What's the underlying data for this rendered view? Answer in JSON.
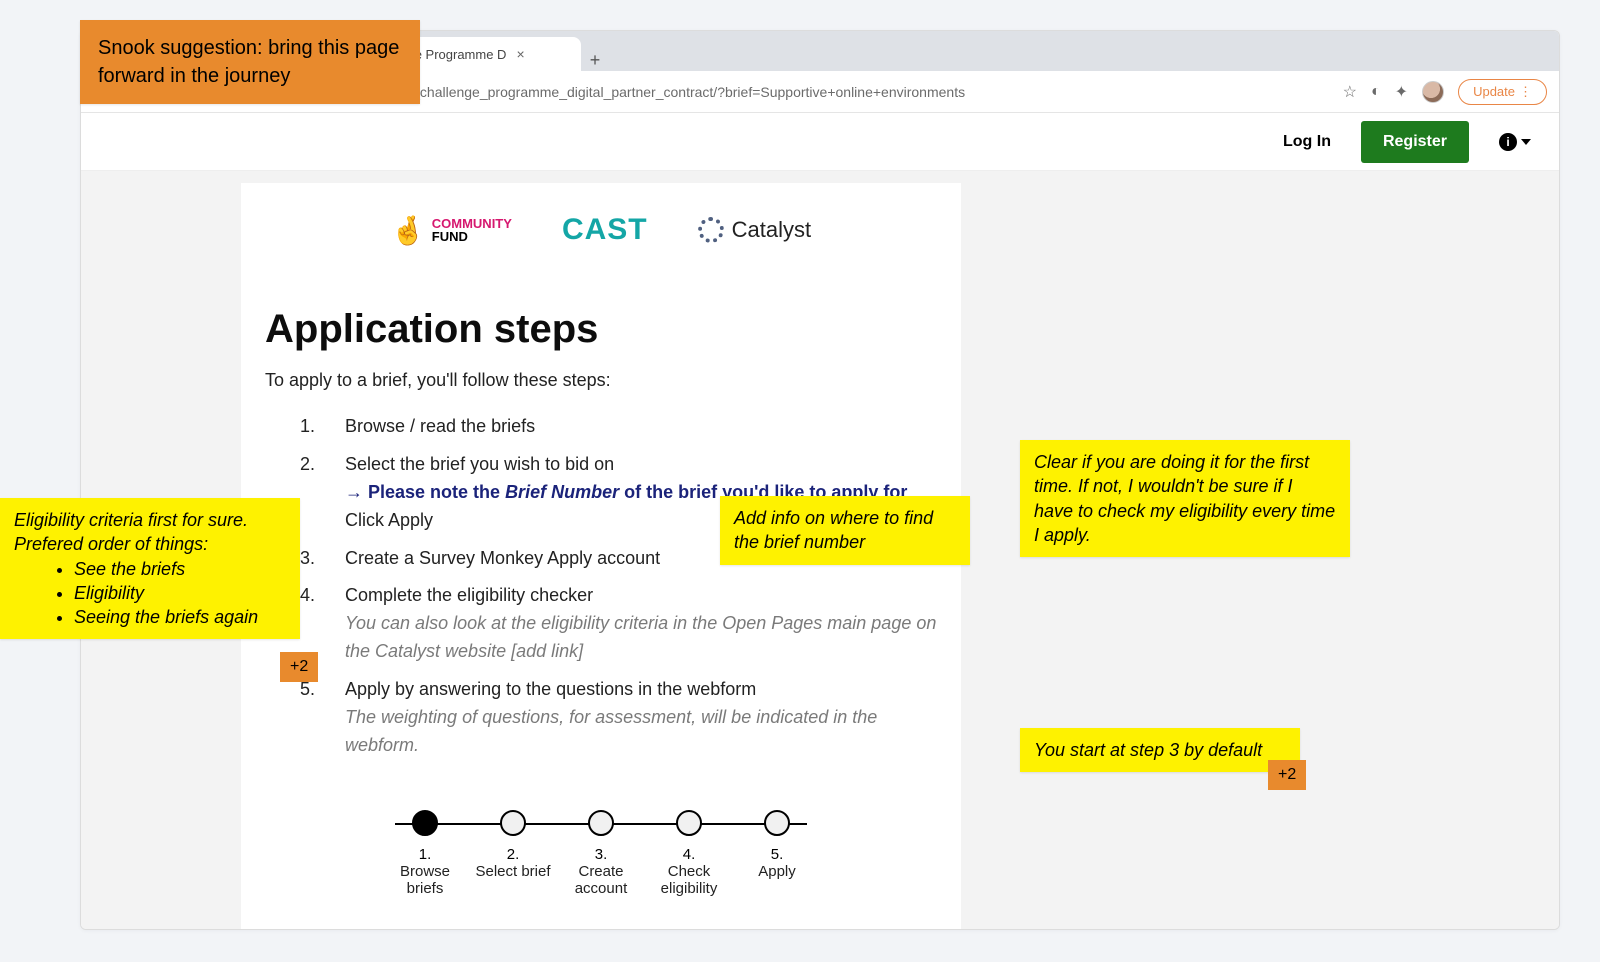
{
  "browser": {
    "tab_title": "enge Programme D",
    "url_fragment": "ector_challenge_programme_digital_partner_contract/?brief=Supportive+online+environments",
    "update_label": "Update"
  },
  "site_header": {
    "login": "Log In",
    "register": "Register"
  },
  "logos": {
    "community_fund_top": "COMMUNITY",
    "community_fund_bottom": "FUND",
    "cast": "CAST",
    "catalyst": "Catalyst"
  },
  "page": {
    "title": "Application steps",
    "intro": "To apply to a brief, you'll follow these steps:",
    "steps": [
      {
        "n": "1.",
        "text": "Browse / read the briefs"
      },
      {
        "n": "2.",
        "text": "Select the brief you wish to bid on",
        "sub_blue_prefix": "→ Please note the ",
        "sub_blue_em": "Brief Number",
        "sub_blue_suffix": " of the brief you'd like to apply for",
        "sub2": "Click Apply"
      },
      {
        "n": "3.",
        "text": "Create a Survey Monkey Apply account"
      },
      {
        "n": "4.",
        "text": "Complete the eligibility checker",
        "italic": "You can also look at the eligibility criteria in the Open Pages main page on the Catalyst website [add link]"
      },
      {
        "n": "5.",
        "text": "Apply by answering to the questions in the webform",
        "italic": "The weighting of questions, for assessment, will be indicated in the webform."
      }
    ],
    "progress": [
      {
        "n": "1.",
        "label": "Browse briefs",
        "filled": true
      },
      {
        "n": "2.",
        "label": "Select brief",
        "filled": false
      },
      {
        "n": "3.",
        "label": "Create account",
        "filled": false
      },
      {
        "n": "4.",
        "label": "Check eligibility",
        "filled": false
      },
      {
        "n": "5.",
        "label": "Apply",
        "filled": false
      }
    ]
  },
  "annotations": {
    "orange_top": "Snook suggestion: bring this page forward in the journey",
    "yellow_left_l1": "Eligibility criteria first for sure.",
    "yellow_left_l2": "Prefered order of things:",
    "yellow_left_b1": "See the briefs",
    "yellow_left_b2": "Eligibility",
    "yellow_left_b3": "Seeing the briefs again",
    "badge_left": "+2",
    "yellow_mid": "Add info on where to find the brief number",
    "yellow_right_top": "Clear if you are doing it for the first time. If not, I wouldn't be sure if I have to check my eligibility every time I apply.",
    "yellow_right_bottom": "You start at step 3 by default",
    "badge_right": "+2"
  }
}
